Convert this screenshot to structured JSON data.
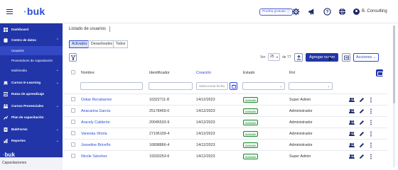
{
  "topbar": {
    "logo_text": "buk",
    "trial_label": "Prueba gratuita",
    "company": "B. Consulting"
  },
  "sidebar": {
    "items": [
      {
        "label": "Dashboard",
        "icon": "dashboard-icon",
        "chevron": false
      },
      {
        "label": "Centro de datos",
        "icon": "database-icon",
        "chevron": true
      },
      {
        "label": "Cursos E-Learning",
        "icon": "laptop-icon",
        "chevron": true
      },
      {
        "label": "Rutas de aprendizaje",
        "icon": "route-icon",
        "chevron": false
      },
      {
        "label": "Cursos Presenciales",
        "icon": "classroom-icon",
        "chevron": true
      },
      {
        "label": "Plan de capacitación",
        "icon": "plan-icon",
        "chevron": false
      },
      {
        "label": "BukForms",
        "icon": "form-icon",
        "chevron": true
      },
      {
        "label": "Reportes",
        "icon": "report-icon",
        "chevron": true
      }
    ],
    "subitems": [
      {
        "label": "Usuarios",
        "active": true
      },
      {
        "label": "Proveedores de capacitación",
        "active": false
      },
      {
        "label": "Multimedia",
        "active": false
      }
    ],
    "footer_logo": "buk",
    "footer_label": "Capacitaciones"
  },
  "main": {
    "title": "Listado de usuarios",
    "filters": [
      "Activados",
      "Desactivados",
      "Todos"
    ],
    "pagination": {
      "show_label": "Ver",
      "per_page": "25",
      "of_label": "de",
      "total": "77"
    },
    "add_button": "Agregar nuevo",
    "actions_button": "Acciones",
    "columns": [
      "Nombre",
      "Identificador",
      "Creación",
      "Estado",
      "Rol"
    ],
    "date_placeholder": "Seleccionar fecha",
    "rows": [
      {
        "name": "Oskar Recabarren",
        "id": "16322711-8",
        "date": "14/12/2023",
        "status": "Activado",
        "role": "Super Admin"
      },
      {
        "name": "Anacarina García",
        "id": "25178459-0",
        "date": "14/12/2023",
        "status": "Activado",
        "role": "Administrador"
      },
      {
        "name": "Aracely Calderón",
        "id": "20045533-9",
        "date": "14/12/2023",
        "status": "Activado",
        "role": "Administrador"
      },
      {
        "name": "Vaneska Vitoria",
        "id": "27195109-4",
        "date": "14/12/2023",
        "status": "Activado",
        "role": "Administrador"
      },
      {
        "name": "Josseline Briceño",
        "id": "16898866-4",
        "date": "14/12/2023",
        "status": "Activado",
        "role": "Administrador"
      },
      {
        "name": "Nicole Sánchez",
        "id": "19333253-6",
        "date": "14/12/2023",
        "status": "Activado",
        "role": "Super Admin"
      }
    ]
  },
  "colors": {
    "primary": "#2135a8",
    "accent": "#1cc7c1",
    "link": "#2c4bd8",
    "success": "#1a8a2e"
  }
}
